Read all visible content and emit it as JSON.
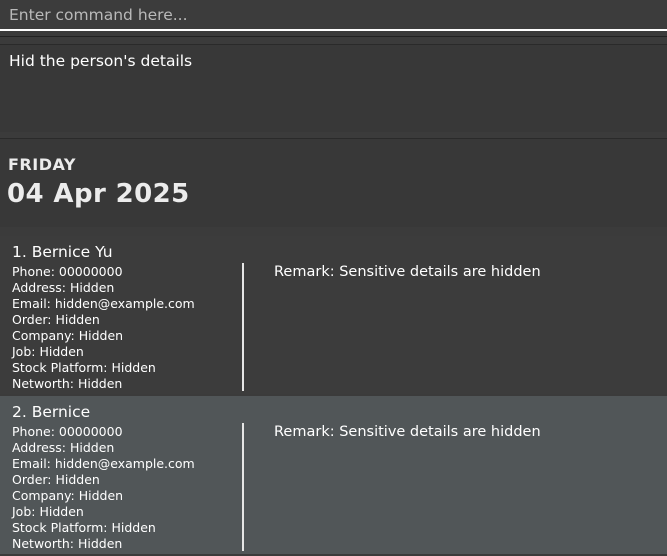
{
  "command_box": {
    "placeholder": "Enter command here...",
    "value": ""
  },
  "result_display": {
    "text": "Hid the person's details"
  },
  "date_panel": {
    "day": "FRIDAY",
    "date": "04 Apr 2025"
  },
  "persons": [
    {
      "name": "1. Bernice Yu",
      "phone": "Phone: 00000000",
      "address": "Address: Hidden",
      "email": "Email: hidden@example.com",
      "order": "Order: Hidden",
      "company": "Company: Hidden",
      "job": "Job: Hidden",
      "stock_platform": "Stock Platform: Hidden",
      "networth": "Networth: Hidden",
      "remark": "Remark: Sensitive details are hidden"
    },
    {
      "name": "2. Bernice",
      "phone": "Phone: 00000000",
      "address": "Address: Hidden",
      "email": "Email: hidden@example.com",
      "order": "Order: Hidden",
      "company": "Company: Hidden",
      "job": "Job: Hidden",
      "stock_platform": "Stock Platform: Hidden",
      "networth": "Networth: Hidden",
      "remark": "Remark: Sensitive details are hidden"
    }
  ]
}
